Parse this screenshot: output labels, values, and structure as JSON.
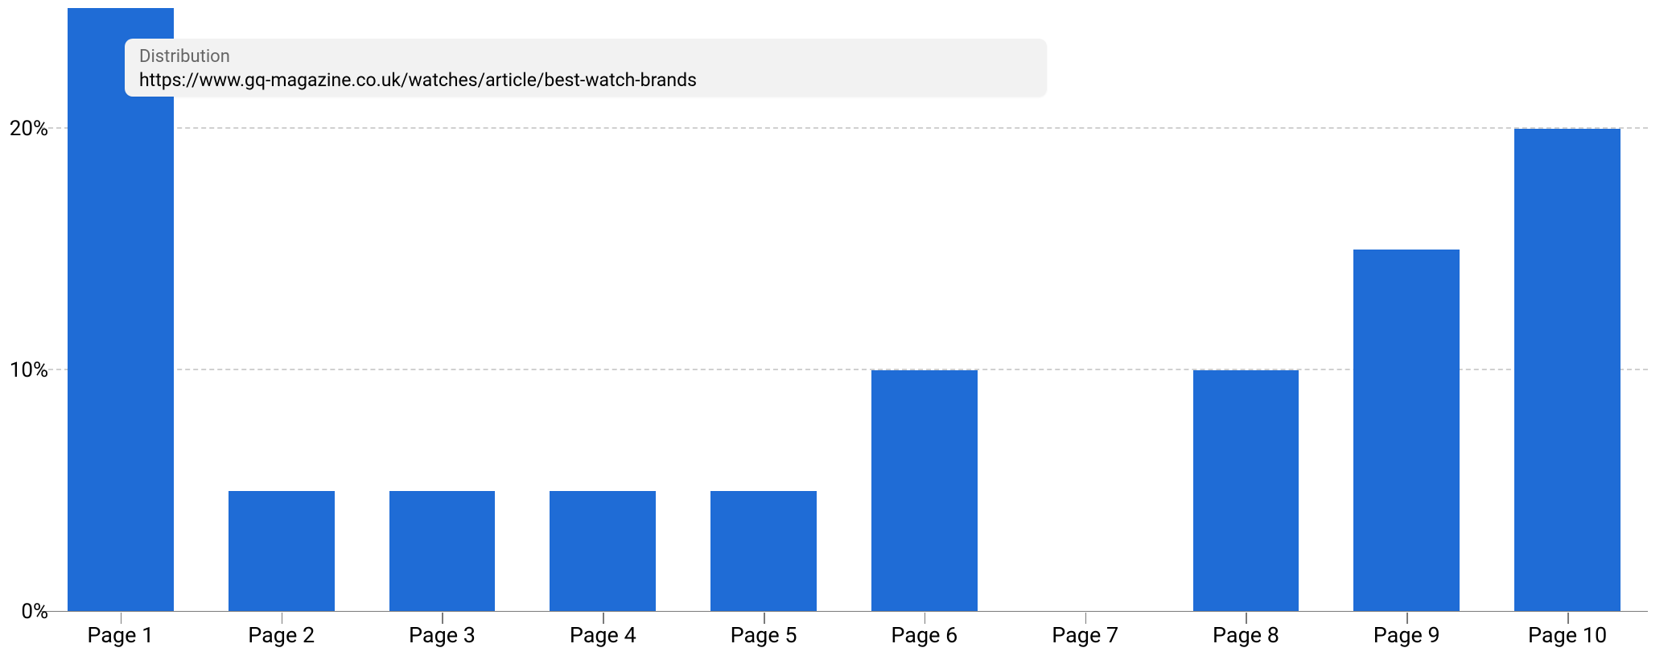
{
  "chart_data": {
    "type": "bar",
    "categories": [
      "Page 1",
      "Page 2",
      "Page 3",
      "Page 4",
      "Page 5",
      "Page 6",
      "Page 7",
      "Page 8",
      "Page 9",
      "Page 10"
    ],
    "values": [
      25,
      5,
      5,
      5,
      5,
      10,
      0,
      10,
      15,
      20
    ],
    "ylabel": "",
    "xlabel": "",
    "ylim": [
      0,
      25
    ],
    "y_ticks": [
      0,
      10,
      20
    ],
    "y_tick_labels": [
      "0%",
      "10%",
      "20%"
    ],
    "bar_color": "#1f6cd6",
    "grid_dashed": true
  },
  "tooltip": {
    "title": "Distribution",
    "value": "https://www.gq-magazine.co.uk/watches/article/best-watch-brands"
  }
}
